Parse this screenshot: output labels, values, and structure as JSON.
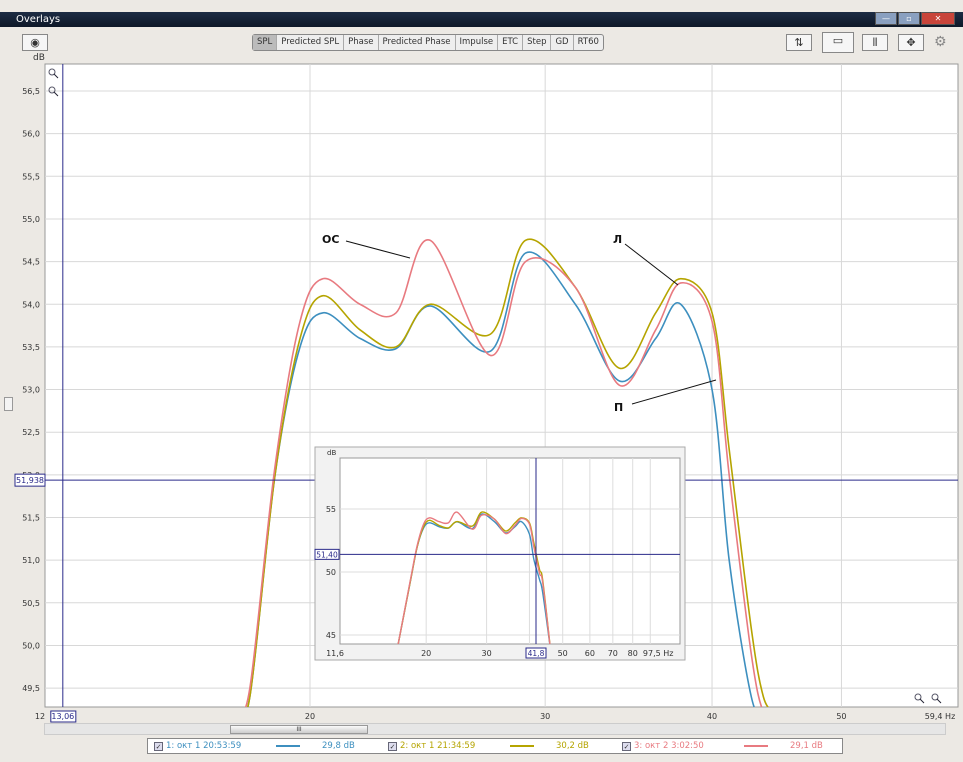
{
  "window": {
    "title": "Overlays",
    "controls": [
      "—",
      "▫",
      "✕"
    ]
  },
  "tabs": [
    {
      "label": "SPL",
      "active": true
    },
    {
      "label": "Predicted SPL"
    },
    {
      "label": "Phase"
    },
    {
      "label": "Predicted Phase"
    },
    {
      "label": "Impulse"
    },
    {
      "label": "ETC"
    },
    {
      "label": "Step"
    },
    {
      "label": "GD"
    },
    {
      "label": "RT60"
    }
  ],
  "toolbar_icons": [
    "camera-icon",
    "sync-icon",
    "zoom-window-icon",
    "grid-icon",
    "pan-arrows-icon",
    "gear-icon"
  ],
  "annotations": {
    "os": "ОС",
    "l": "Л",
    "p": "П"
  },
  "chart_data": [
    {
      "type": "line",
      "title": "SPL overlay",
      "ylabel": "dB",
      "xlabel": "Hz",
      "xscale": "log",
      "xlim": [
        12.06,
        59.4
      ],
      "ylim": [
        49.4,
        56.7
      ],
      "yticks": [
        "56,5",
        "56,0",
        "55,5",
        "55,0",
        "54,5",
        "54,0",
        "53,5",
        "53,0",
        "52,5",
        "52,0",
        "51,5",
        "51,0",
        "50,5",
        "50,0",
        "49,5"
      ],
      "xticks": [
        "12",
        "20",
        "30",
        "40",
        "50",
        "59,4 Hz"
      ],
      "cursor": {
        "x_label": "13,06",
        "y_label": "51,938",
        "x": 13.06,
        "y": 51.938
      },
      "x": [
        17.6,
        18.03,
        18.83,
        19.66,
        20.46,
        21.8,
        23.2,
        24.6,
        27.3,
        29.0,
        31.6,
        34.1,
        36.3,
        37.9,
        40,
        41.2,
        42.8,
        43.7,
        44.5
      ],
      "series": [
        {
          "name": "1: окт 1 20:53:59",
          "color": "#3d8fbf",
          "values": [
            48.5,
            49.4,
            52.0,
            53.5,
            53.9,
            53.6,
            53.48,
            53.98,
            53.45,
            54.6,
            54.0,
            53.1,
            53.6,
            54.0,
            53.0,
            51.0,
            49.4,
            48.4,
            47.5
          ]
        },
        {
          "name": "2: окт 1 21:34:59",
          "color": "#b5a400",
          "values": [
            48.5,
            49.4,
            52.0,
            53.6,
            54.1,
            53.7,
            53.5,
            54.0,
            53.65,
            54.75,
            54.2,
            53.25,
            53.9,
            54.3,
            53.9,
            52.3,
            50.2,
            49.4,
            48.6
          ]
        },
        {
          "name": "3: окт 2 3:02:50",
          "color": "#e87a80",
          "values": [
            48.6,
            49.5,
            52.1,
            53.8,
            54.3,
            54.0,
            53.9,
            54.75,
            53.4,
            54.5,
            54.2,
            53.05,
            53.7,
            54.25,
            53.8,
            52.0,
            49.9,
            49.2,
            48.4
          ]
        }
      ]
    },
    {
      "type": "line",
      "title": "overview inset",
      "ylabel": "dB",
      "xscale": "log",
      "xlim": [
        11.6,
        97.5
      ],
      "ylim": [
        44.6,
        59
      ],
      "yticks": [
        "55",
        "50",
        "45"
      ],
      "xticks": [
        "11,6",
        "20",
        "30",
        "50",
        "60",
        "70",
        "80",
        "97,5 Hz"
      ],
      "cursor": {
        "x_label": "41,8",
        "y_label": "51,40"
      }
    }
  ],
  "legend": [
    {
      "label": "1: окт 1 20:53:59",
      "value": "29,8 dB",
      "color": "#3d8fbf"
    },
    {
      "label": "2: окт 1 21:34:59",
      "value": "30,2 dB",
      "color": "#b5a400"
    },
    {
      "label": "3: окт 2 3:02:50",
      "value": "29,1 dB",
      "color": "#e87a80"
    }
  ]
}
